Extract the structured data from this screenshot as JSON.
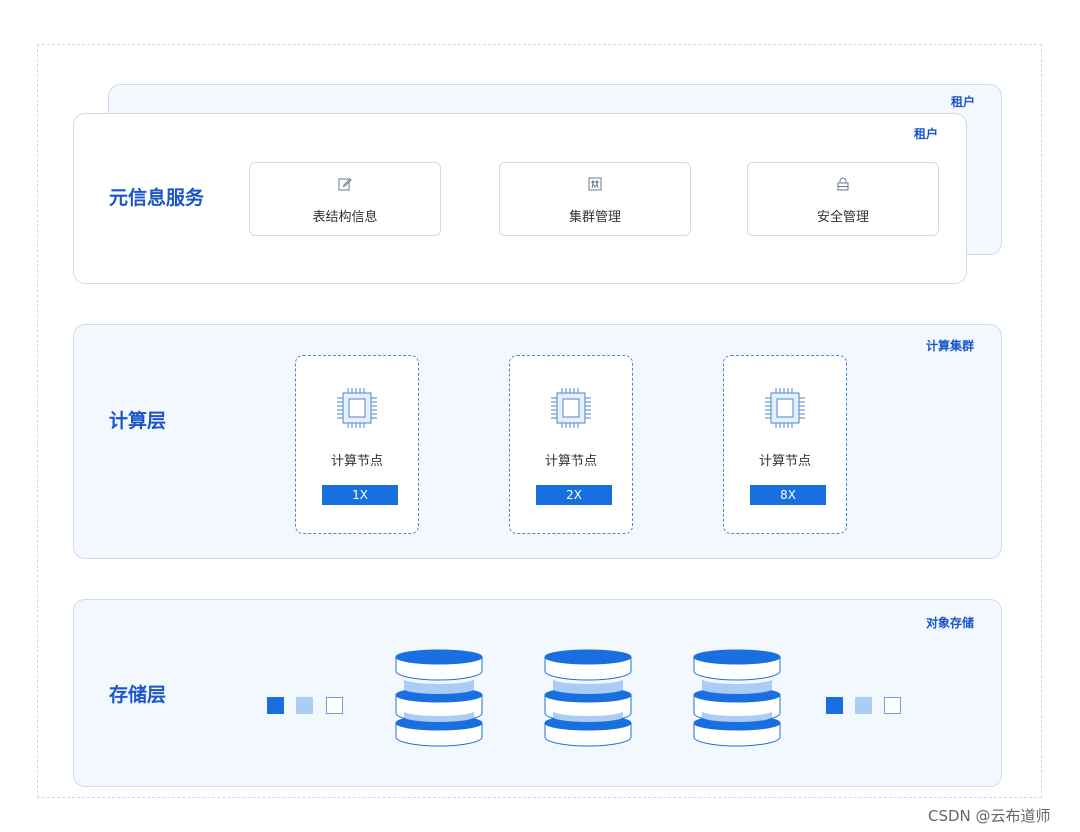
{
  "tenant_back": {
    "tag": "租户"
  },
  "metadata": {
    "title": "元信息服务",
    "tag": "租户",
    "cards": [
      {
        "label": "表结构信息",
        "icon": "edit-icon"
      },
      {
        "label": "集群管理",
        "icon": "cluster-icon"
      },
      {
        "label": "安全管理",
        "icon": "lock-icon"
      }
    ]
  },
  "compute": {
    "title": "计算层",
    "tag": "计算集群",
    "nodes": [
      {
        "label": "计算节点",
        "scale": "1X",
        "icon": "cpu-chip-icon"
      },
      {
        "label": "计算节点",
        "scale": "2X",
        "icon": "cpu-chip-icon"
      },
      {
        "label": "计算节点",
        "scale": "8X",
        "icon": "cpu-chip-icon"
      }
    ]
  },
  "storage": {
    "title": "存储层",
    "tag": "对象存储",
    "icons": [
      "database-icon",
      "database-icon",
      "database-icon"
    ]
  },
  "colors": {
    "accent": "#1a56c9",
    "primary_blue": "#1a6fe0",
    "light_blue": "#a9cdf5",
    "panel_bg": "#f3f8fe"
  },
  "watermark": "CSDN @云布道师"
}
